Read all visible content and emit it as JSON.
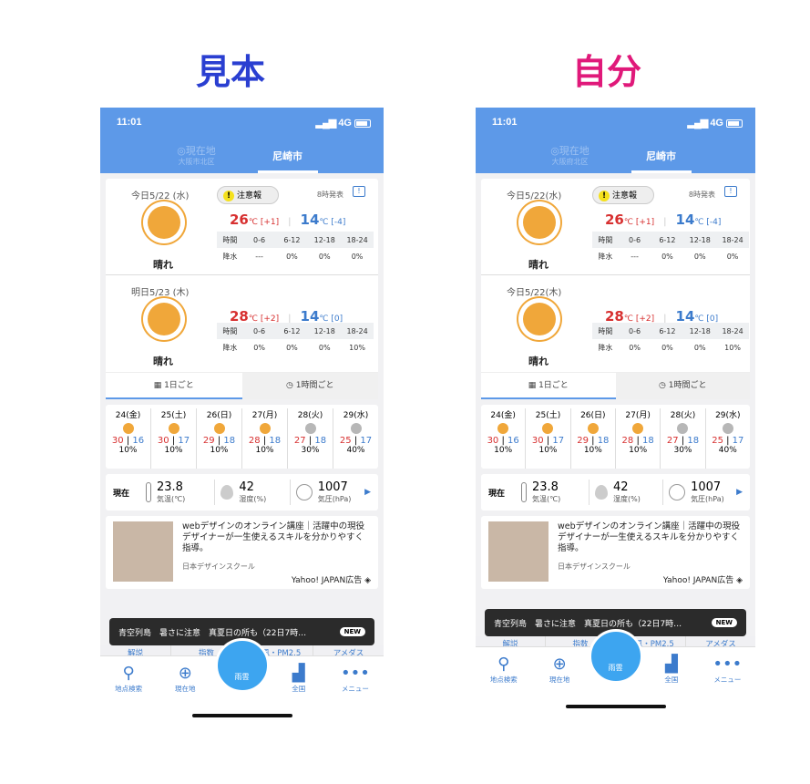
{
  "labels": {
    "left": "見本",
    "right": "自分"
  },
  "left": {
    "status": {
      "time": "11:01",
      "network": "4G"
    },
    "tabs": [
      {
        "label": "現在地",
        "sub": "大阪市北区"
      },
      {
        "label": "尼崎市"
      }
    ],
    "alert": "注意報",
    "published": "8時発表",
    "days": [
      {
        "date": "今日5/22 (水)",
        "cond": "晴れ",
        "hi": "26",
        "hi_diff": "[+1]",
        "lo": "14",
        "lo_diff": "[-4]",
        "rain": [
          "---",
          "0%",
          "0%",
          "0%"
        ]
      },
      {
        "date": "明日5/23 (木)",
        "cond": "晴れ",
        "hi": "28",
        "hi_diff": "[+2]",
        "lo": "14",
        "lo_diff": "[0]",
        "rain": [
          "0%",
          "0%",
          "0%",
          "10%"
        ]
      }
    ],
    "grid_head": [
      "時間",
      "0-6",
      "6-12",
      "12-18",
      "18-24"
    ],
    "rain_label": "降水",
    "mode_tabs": [
      "1日ごと",
      "1時間ごと"
    ],
    "week": [
      {
        "d": "24(金)",
        "hi": "30",
        "lo": "16",
        "p": "10%"
      },
      {
        "d": "25(土)",
        "hi": "30",
        "lo": "17",
        "p": "10%"
      },
      {
        "d": "26(日)",
        "hi": "29",
        "lo": "18",
        "p": "10%"
      },
      {
        "d": "27(月)",
        "hi": "28",
        "lo": "18",
        "p": "10%"
      },
      {
        "d": "28(火)",
        "hi": "27",
        "lo": "18",
        "p": "30%"
      },
      {
        "d": "29(水)",
        "hi": "25",
        "lo": "17",
        "p": "40%"
      }
    ],
    "now": {
      "label": "現在",
      "temp": "23.8",
      "temp_u": "気温(℃)",
      "hum": "42",
      "hum_u": "湿度(%)",
      "pres": "1007",
      "pres_u": "気圧(hPa)"
    },
    "ad": {
      "text": "webデザインのオンライン講座｜活躍中の現役デザイナーが一生使えるスキルを分かりやすく指導。",
      "src": "日本デザインスクール",
      "sponsor": "Yahoo! JAPAN広告"
    },
    "news": "青空列島　暑さに注意　真夏日の所も（22日7時…",
    "news_badge": "NEW",
    "sub_tabs": [
      "解説",
      "指数",
      "波風・PM2.5",
      "アメダス"
    ],
    "nav": [
      "地点検索",
      "現在地",
      "雨雲",
      "全国",
      "メニュー"
    ]
  },
  "right": {
    "status": {
      "time": "11:01",
      "network": "4G"
    },
    "tabs": [
      {
        "label": "現在地",
        "sub": "大阪府北区"
      },
      {
        "label": "尼崎市"
      }
    ],
    "alert": "注意報",
    "published": "8時発表",
    "days": [
      {
        "date": "今日5/22(水)",
        "cond": "晴れ",
        "hi": "26",
        "hi_diff": "[+1]",
        "lo": "14",
        "lo_diff": "[-4]",
        "rain": [
          "---",
          "0%",
          "0%",
          "0%"
        ]
      },
      {
        "date": "今日5/22(木)",
        "cond": "晴れ",
        "hi": "28",
        "hi_diff": "[+2]",
        "lo": "14",
        "lo_diff": "[0]",
        "rain": [
          "0%",
          "0%",
          "0%",
          "10%"
        ]
      }
    ],
    "grid_head": [
      "時間",
      "0-6",
      "6-12",
      "12-18",
      "18-24"
    ],
    "rain_label": "降水",
    "mode_tabs": [
      "1日ごと",
      "1時間ごと"
    ],
    "week": [
      {
        "d": "24(金)",
        "hi": "30",
        "lo": "16",
        "p": "10%"
      },
      {
        "d": "25(土)",
        "hi": "30",
        "lo": "17",
        "p": "10%"
      },
      {
        "d": "26(日)",
        "hi": "29",
        "lo": "18",
        "p": "10%"
      },
      {
        "d": "27(月)",
        "hi": "28",
        "lo": "18",
        "p": "10%"
      },
      {
        "d": "28(火)",
        "hi": "27",
        "lo": "18",
        "p": "30%"
      },
      {
        "d": "29(水)",
        "hi": "25",
        "lo": "17",
        "p": "40%"
      }
    ],
    "now": {
      "label": "現在",
      "temp": "23.8",
      "temp_u": "気温(℃)",
      "hum": "42",
      "hum_u": "湿度(%)",
      "pres": "1007",
      "pres_u": "気圧(hPa)"
    },
    "ad": {
      "text": "webデザインのオンライン講座｜活躍中の現役デザイナーが一生使えるスキルを分かりやすく指導。",
      "src": "日本デザインスクール",
      "sponsor": "Yahoo! JAPAN広告"
    },
    "news": "青空列島　暑さに注意　真夏日の所も（22日7時…",
    "news_badge": "NEW",
    "sub_tabs": [
      "解説",
      "指数",
      "波風・PM2.5",
      "アメダス"
    ],
    "nav": [
      "地点検索",
      "現在地",
      "雨雲",
      "全国",
      "メニュー"
    ]
  }
}
